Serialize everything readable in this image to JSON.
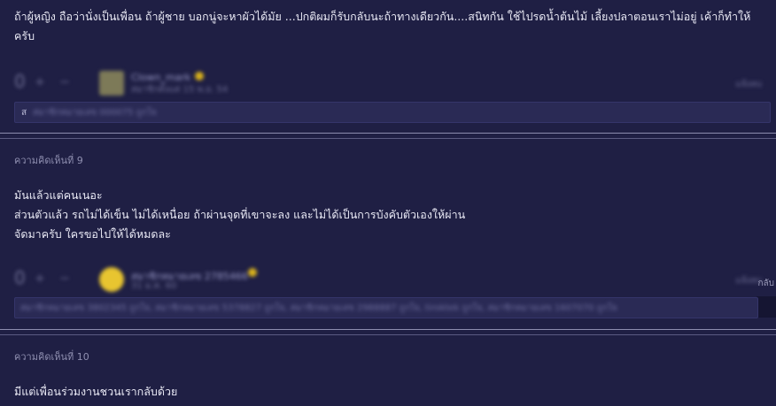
{
  "comment_top": {
    "body": "ถ้าผู้หญิง ถือว่านั่งเป็นเพื่อน ถ้าผู้ชาย บอกนู่จะหาผัวได้มัย ...ปกติผมก็รับกลับนะถ้าทางเดียวกัน....สนิทกัน ใช้ไปรดน้ำต้นไม้ เลี้ยงปลาตอนเราไม่อยู่ เค้าก็ทำให้ครับ",
    "vote_count": "0",
    "username": "Clown_mark",
    "date": "สมาชิกตั้งแต่ 15 พ.ย. 54",
    "reply_link": "แจ้งลบ",
    "reply_prefix": "ส",
    "reply_placeholder": "สมาชิกหมายเลข 000075 ถูกใจ"
  },
  "comment_9": {
    "label": "ความคิดเห็นที่ 9",
    "lines": [
      "มันแล้วแต่คนเนอะ",
      "ส่วนตัวแล้ว รถไม่ได้เข็น ไม่ได้เหนื่อย ถ้าผ่านจุดที่เขาจะลง และไม่ได้เป็นการบังคับตัวเองให้ผ่าน",
      "จัดมาครับ ใครขอไปให้ได้หมดละ"
    ],
    "vote_count": "0",
    "username": "สมาชิกหมายเลข 2785466",
    "date": "31 ม.ค. 60",
    "reply_link": "แจ้งลบ",
    "reply_right_label": "กลับ",
    "reply_placeholder": "สมาชิกหมายเลข 3802345 ถูกใจ, สมาชิกหมายเลข 5378827 ถูกใจ, สมาชิกหมายเลข 2988887 ถูกใจ, tiroktek ถูกใจ, สมาชิกหมายเลข 1607070 ถูกใจ"
  },
  "comment_10": {
    "label": "ความคิดเห็นที่ 10",
    "body": "มีแต่เพื่อนร่วมงานชวนเรากลับด้วย"
  },
  "colors": {
    "background": "#1f1f44",
    "text": "#e8e8f4",
    "muted": "#8f8fb0",
    "badge": "#d9b21c"
  }
}
